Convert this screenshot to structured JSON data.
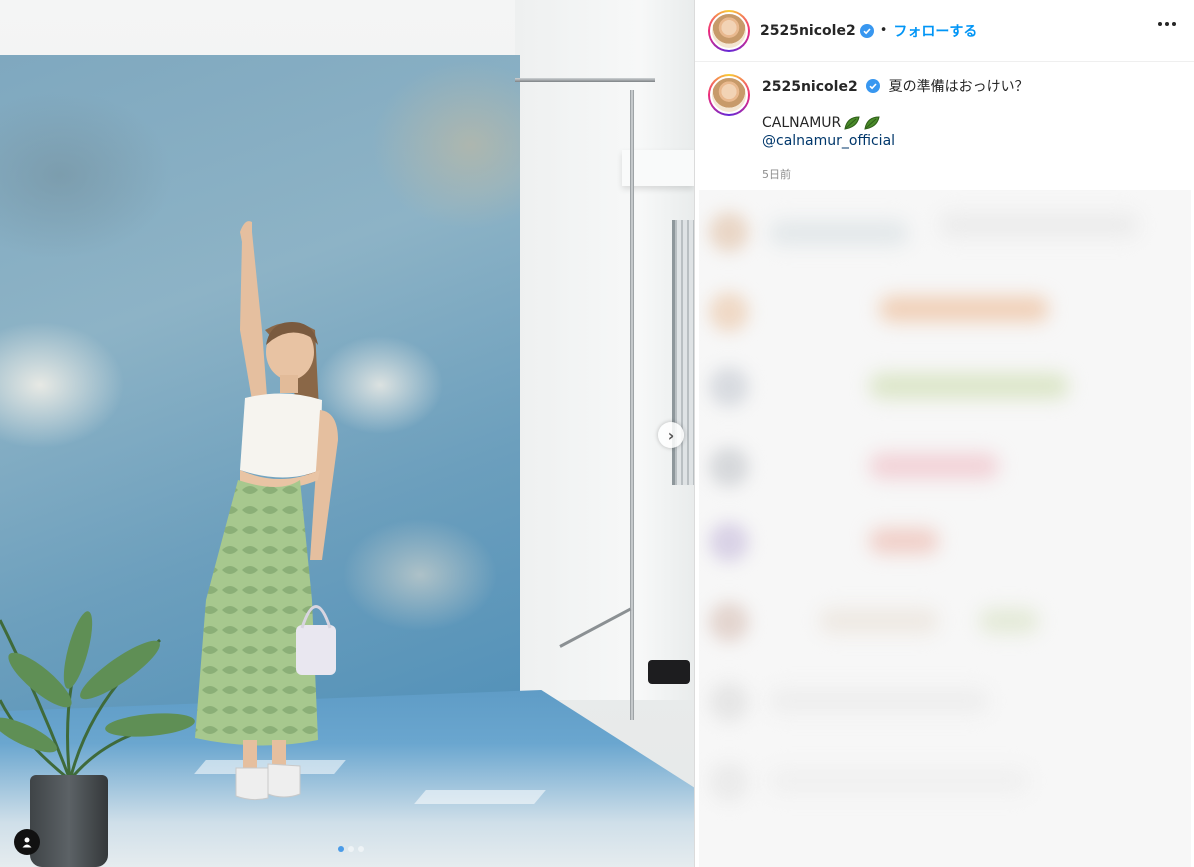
{
  "post": {
    "username": "2525nicole2",
    "follow_label": "フォローする",
    "separator": "•",
    "caption_text": "夏の準備はおっけい？",
    "brand": "CALNAMUR",
    "mention": "@calnamur_official",
    "time_ago": "5日前",
    "carousel_total": 3,
    "carousel_current": 1
  },
  "icons": {
    "verified": "verified-badge-icon",
    "more": "more-options-icon",
    "next": "chevron-right-icon",
    "tag": "user-tag-icon",
    "leaf": "leaf-emoji-icon"
  },
  "colors": {
    "accent": "#0095f6",
    "link": "#00376b",
    "verified": "#3897f0"
  }
}
